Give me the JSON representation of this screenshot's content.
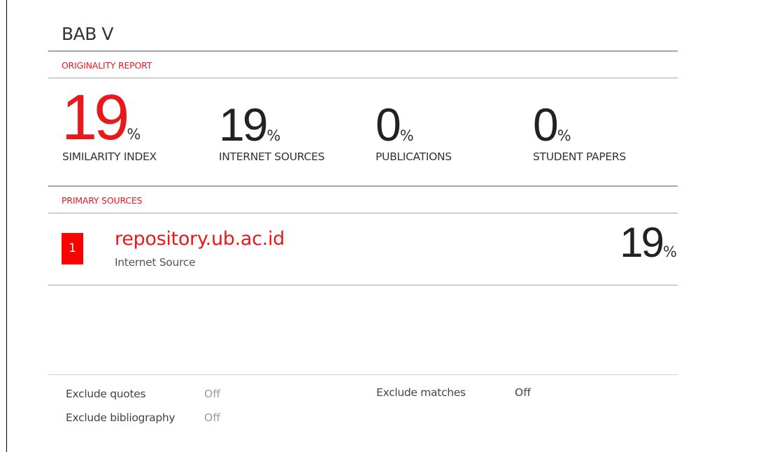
{
  "report": {
    "title": "BAB V",
    "originality_label": "ORIGINALITY REPORT",
    "primary_sources_label": "PRIMARY SOURCES",
    "accent_color": "#e8191c"
  },
  "stats": [
    {
      "value": "19",
      "unit": "%",
      "label": "SIMILARITY INDEX"
    },
    {
      "value": "19",
      "unit": "%",
      "label": "INTERNET SOURCES"
    },
    {
      "value": "0",
      "unit": "%",
      "label": "PUBLICATIONS"
    },
    {
      "value": "0",
      "unit": "%",
      "label": "STUDENT PAPERS"
    }
  ],
  "sources": [
    {
      "rank": "1",
      "name": "repository.ub.ac.id",
      "type": "Internet Source",
      "value": "19",
      "unit": "%"
    }
  ],
  "settings": {
    "exclude_quotes": {
      "label": "Exclude quotes",
      "value": "Off"
    },
    "exclude_bibliography": {
      "label": "Exclude bibliography",
      "value": "Off"
    },
    "exclude_matches": {
      "label": "Exclude matches",
      "value": "Off"
    }
  }
}
